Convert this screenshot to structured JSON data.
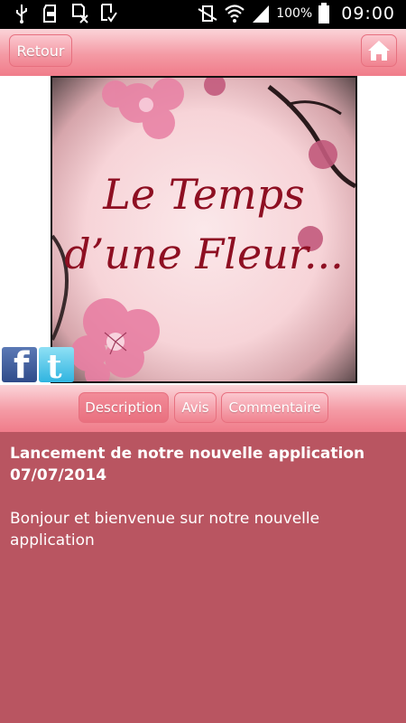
{
  "status_bar": {
    "battery_percent": "100%",
    "time": "09:00"
  },
  "header": {
    "back_label": "Retour"
  },
  "banner": {
    "title_line1": "Le Temps",
    "title_line2": "d’une Fleur..."
  },
  "tabs": [
    {
      "label": "Description",
      "active": true
    },
    {
      "label": "Avis",
      "active": false
    },
    {
      "label": "Commentaire",
      "active": false
    }
  ],
  "content": {
    "title": "Lancement de notre nouvelle application",
    "date": "07/07/2014",
    "body": "Bonjour et bienvenue sur notre nouvelle application"
  },
  "colors": {
    "accent_pink": "#f07c8a",
    "content_background": "#b95561",
    "banner_text": "#8e0f22"
  }
}
